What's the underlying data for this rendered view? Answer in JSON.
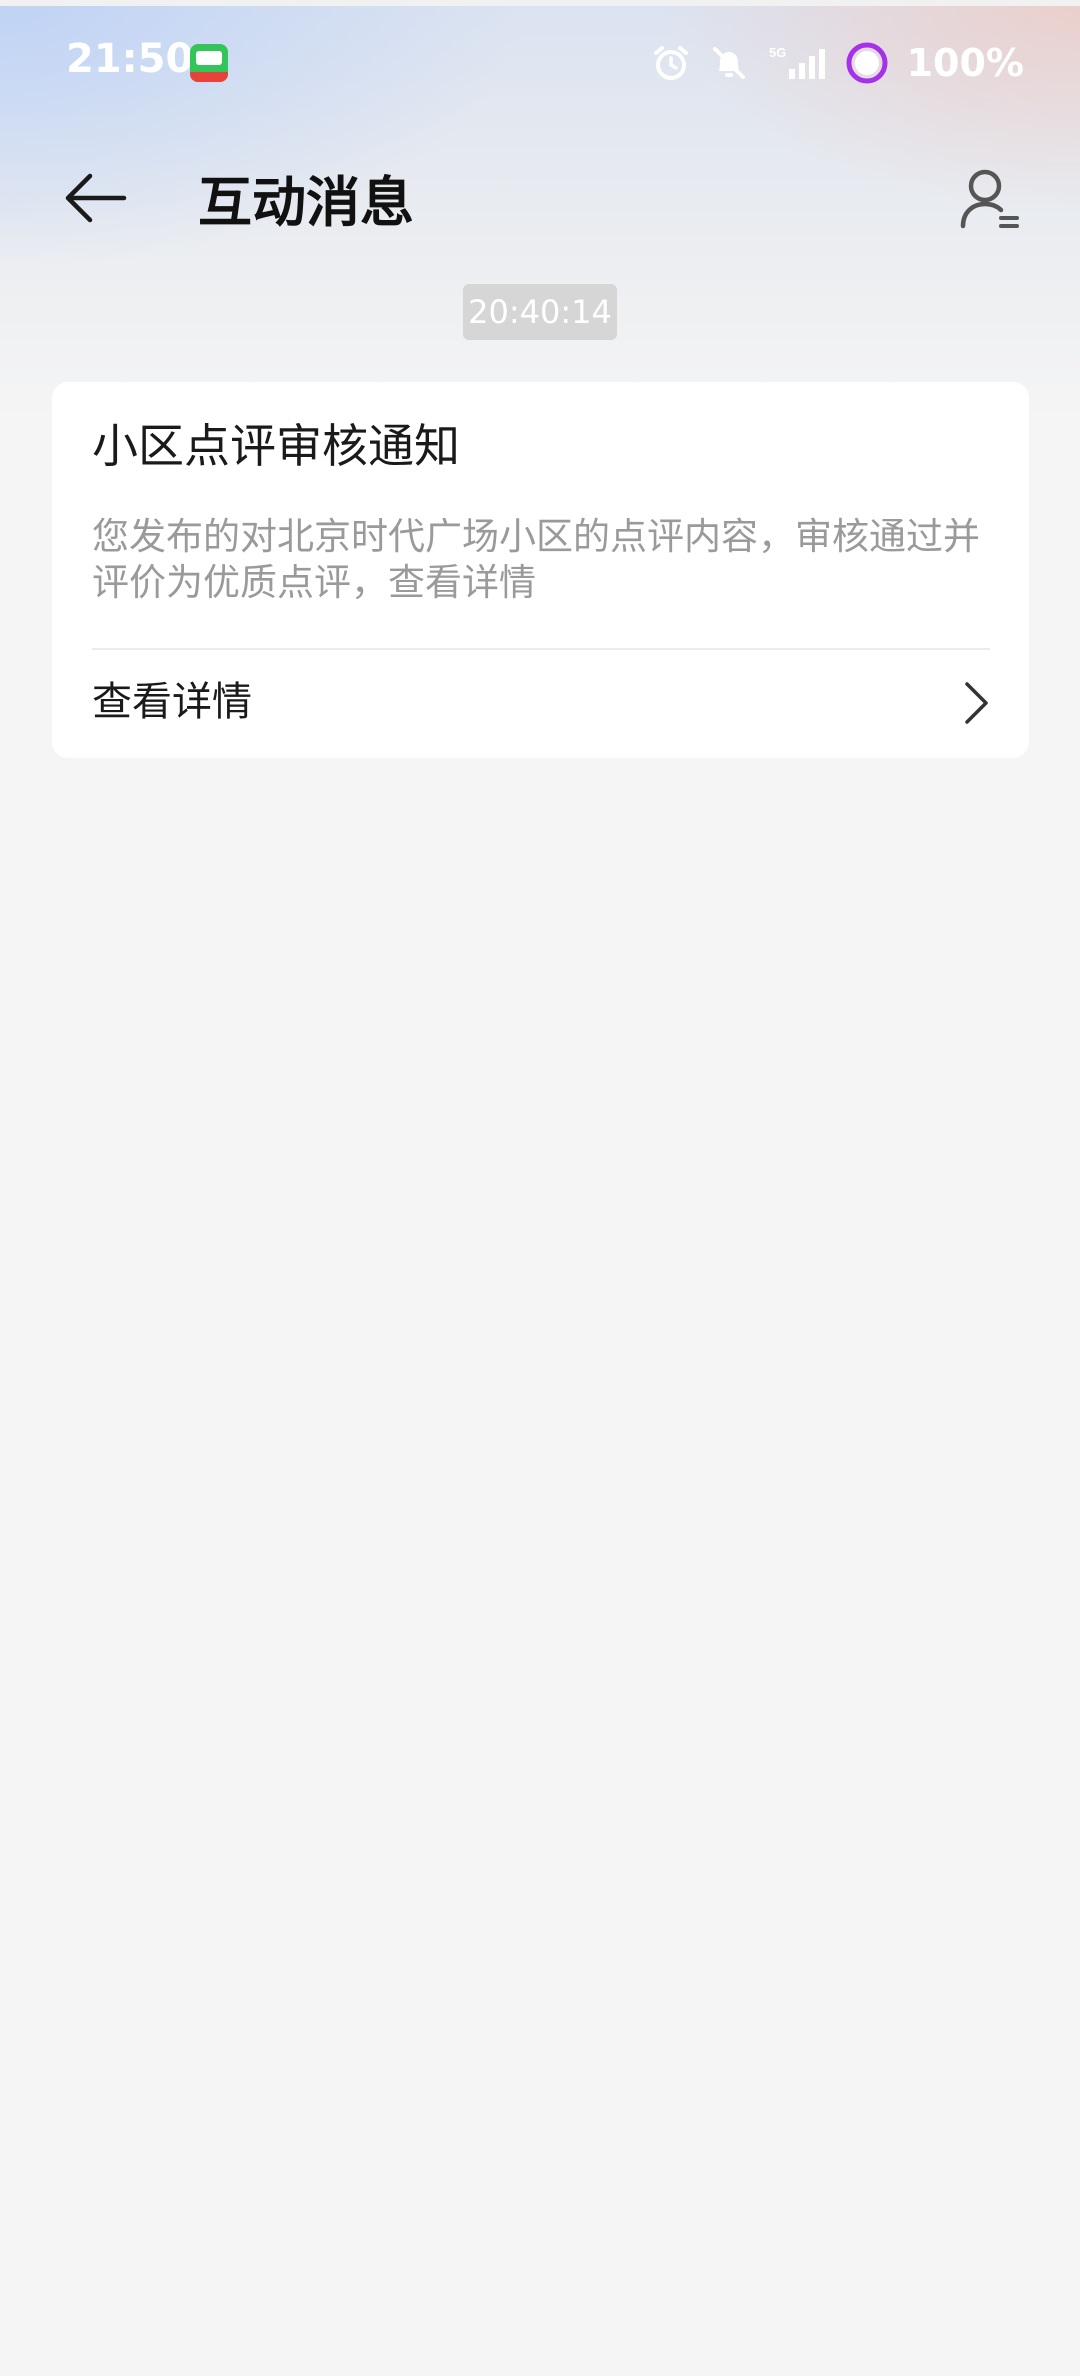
{
  "status_bar": {
    "time": "21:50",
    "app_icon": "app-notification-icon",
    "icons": [
      "alarm-icon",
      "bell-off-icon",
      "signal-5g-icon",
      "battery-ring-icon"
    ],
    "battery": "100%"
  },
  "header": {
    "back_icon": "back-arrow-icon",
    "title": "互动消息",
    "contact_icon": "user-list-icon"
  },
  "messages": [
    {
      "timestamp": "20:40:14",
      "title": "小区点评审核通知",
      "body": "您发布的对北京时代广场小区的点评内容，审核通过并评价为优质点评，查看详情",
      "action_label": "查看详情",
      "action_icon": "chevron-right-icon"
    }
  ],
  "colors": {
    "background": "#f5f5f5",
    "card": "#ffffff",
    "battery_accent": "#a531e8",
    "timestamp_bg": "#d6d6d6"
  }
}
